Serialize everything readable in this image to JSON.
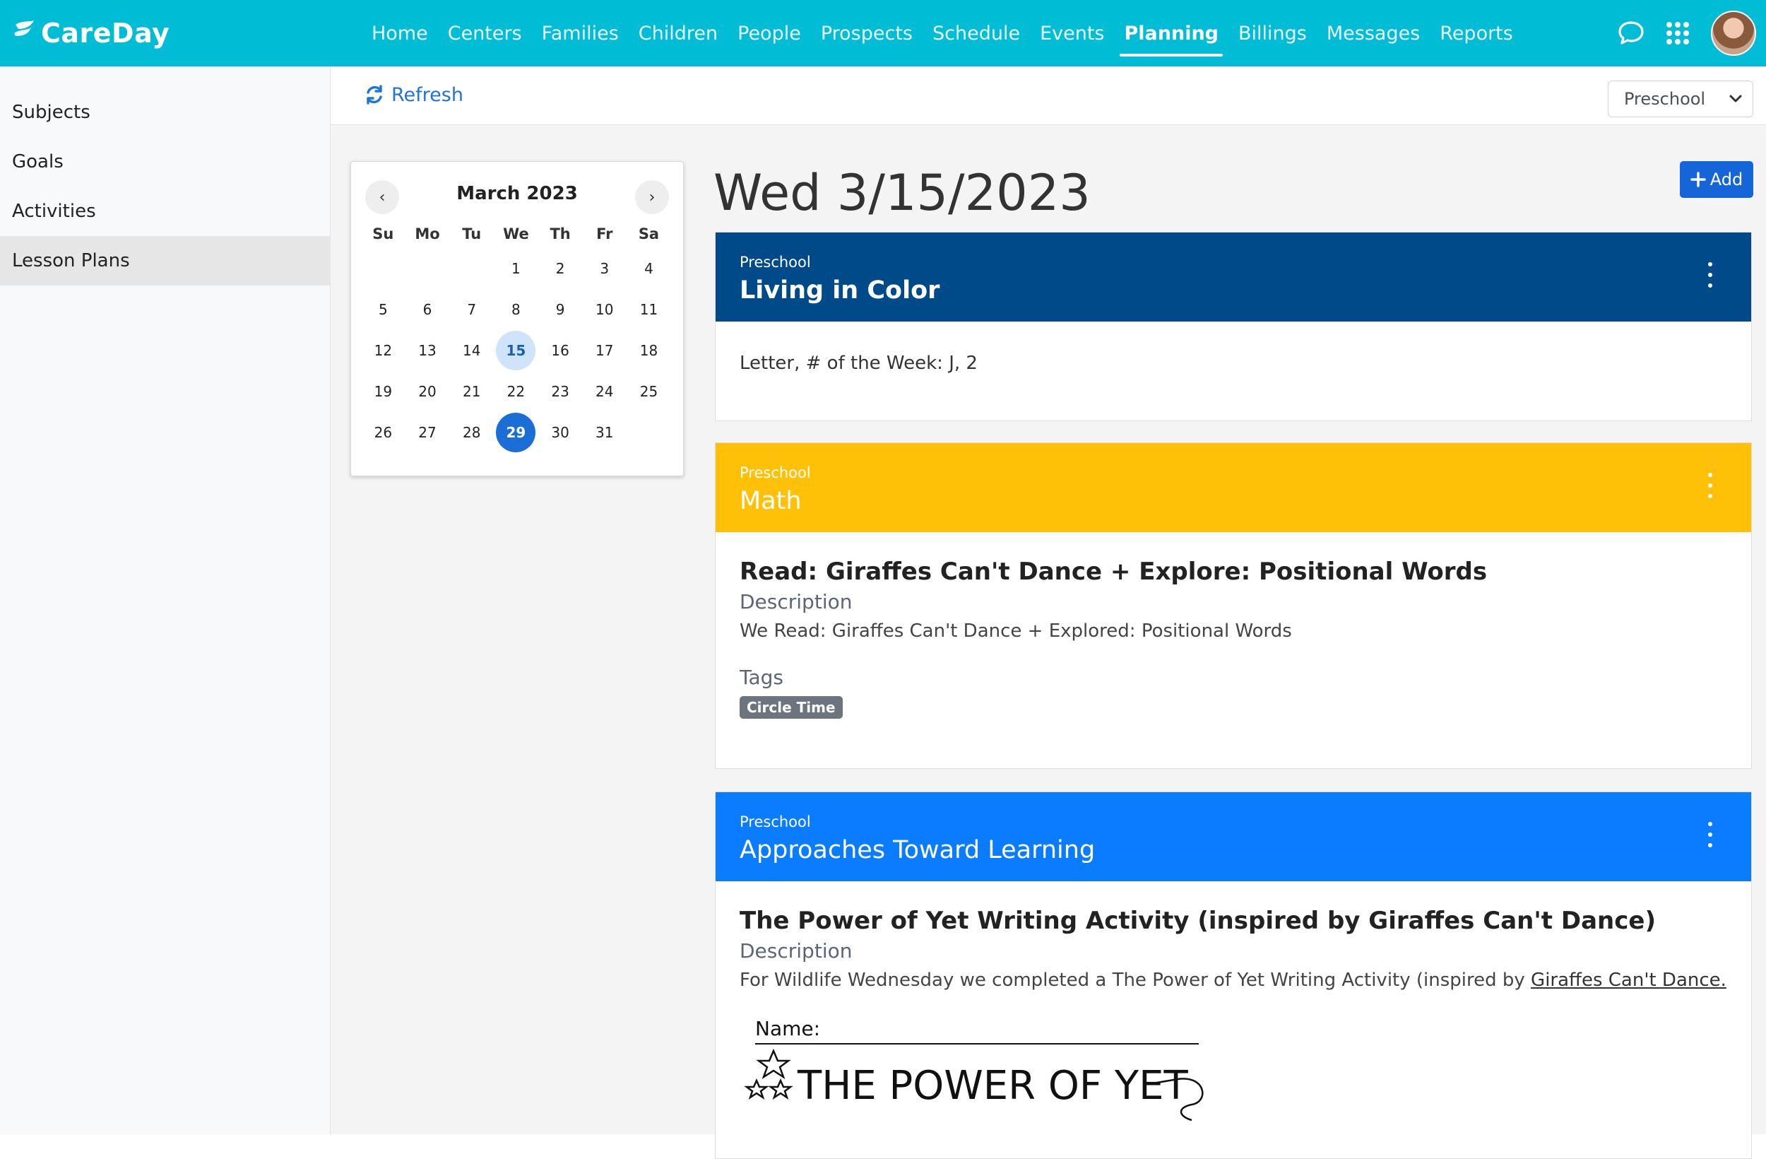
{
  "app": {
    "logo_text": "CareDay",
    "brand_color": "#00bcd4",
    "nav": [
      {
        "label": "Home",
        "active": false
      },
      {
        "label": "Centers",
        "active": false
      },
      {
        "label": "Families",
        "active": false
      },
      {
        "label": "Children",
        "active": false
      },
      {
        "label": "People",
        "active": false
      },
      {
        "label": "Prospects",
        "active": false
      },
      {
        "label": "Schedule",
        "active": false
      },
      {
        "label": "Events",
        "active": false
      },
      {
        "label": "Planning",
        "active": true
      },
      {
        "label": "Billings",
        "active": false
      },
      {
        "label": "Messages",
        "active": false
      },
      {
        "label": "Reports",
        "active": false
      }
    ],
    "icons": [
      "chat-bubble-icon",
      "apps-grid-icon",
      "user-avatar"
    ]
  },
  "sidebar": {
    "items": [
      {
        "label": "Subjects",
        "active": false
      },
      {
        "label": "Goals",
        "active": false
      },
      {
        "label": "Activities",
        "active": false
      },
      {
        "label": "Lesson Plans",
        "active": true
      }
    ]
  },
  "toolbar": {
    "refresh_label": "Refresh",
    "classroom_select": "Preschool"
  },
  "calendar": {
    "title": "March 2023",
    "weekdays": [
      "Su",
      "Mo",
      "Tu",
      "We",
      "Th",
      "Fr",
      "Sa"
    ],
    "leading_blanks": 3,
    "days": [
      "1",
      "2",
      "3",
      "4",
      "5",
      "6",
      "7",
      "8",
      "9",
      "10",
      "11",
      "12",
      "13",
      "14",
      "15",
      "16",
      "17",
      "18",
      "19",
      "20",
      "21",
      "22",
      "23",
      "24",
      "25",
      "26",
      "27",
      "28",
      "29",
      "30",
      "31"
    ],
    "highlighted_day": "15",
    "selected_day": "29"
  },
  "main": {
    "date_title": "Wed 3/15/2023",
    "add_label": "Add",
    "cards": [
      {
        "subtitle": "Preschool",
        "title": "Living in Color",
        "color": "#004a8a",
        "text": "Letter, # of the Week: J, 2"
      },
      {
        "subtitle": "Preschool",
        "title": "Math",
        "color": "#ffc107",
        "activity_title": "Read: Giraffes Can't Dance + Explore: Positional Words",
        "description_label": "Description",
        "description": "We Read: Giraffes Can't Dance + Explored: Positional Words",
        "tags_label": "Tags",
        "tags": [
          "Circle Time"
        ]
      },
      {
        "subtitle": "Preschool",
        "title": "Approaches Toward Learning",
        "color": "#0a7cff",
        "activity_title": "The Power of Yet Writing Activity (inspired by Giraffes Can't Dance)",
        "description_label": "Description",
        "description_prefix": "For Wildlife Wednesday we completed a The Power of Yet Writing Activity (inspired by ",
        "description_link": "Giraffes Can't Dance.",
        "worksheet": {
          "name_label": "Name:",
          "heading": "THE POWER OF YET"
        }
      }
    ]
  }
}
